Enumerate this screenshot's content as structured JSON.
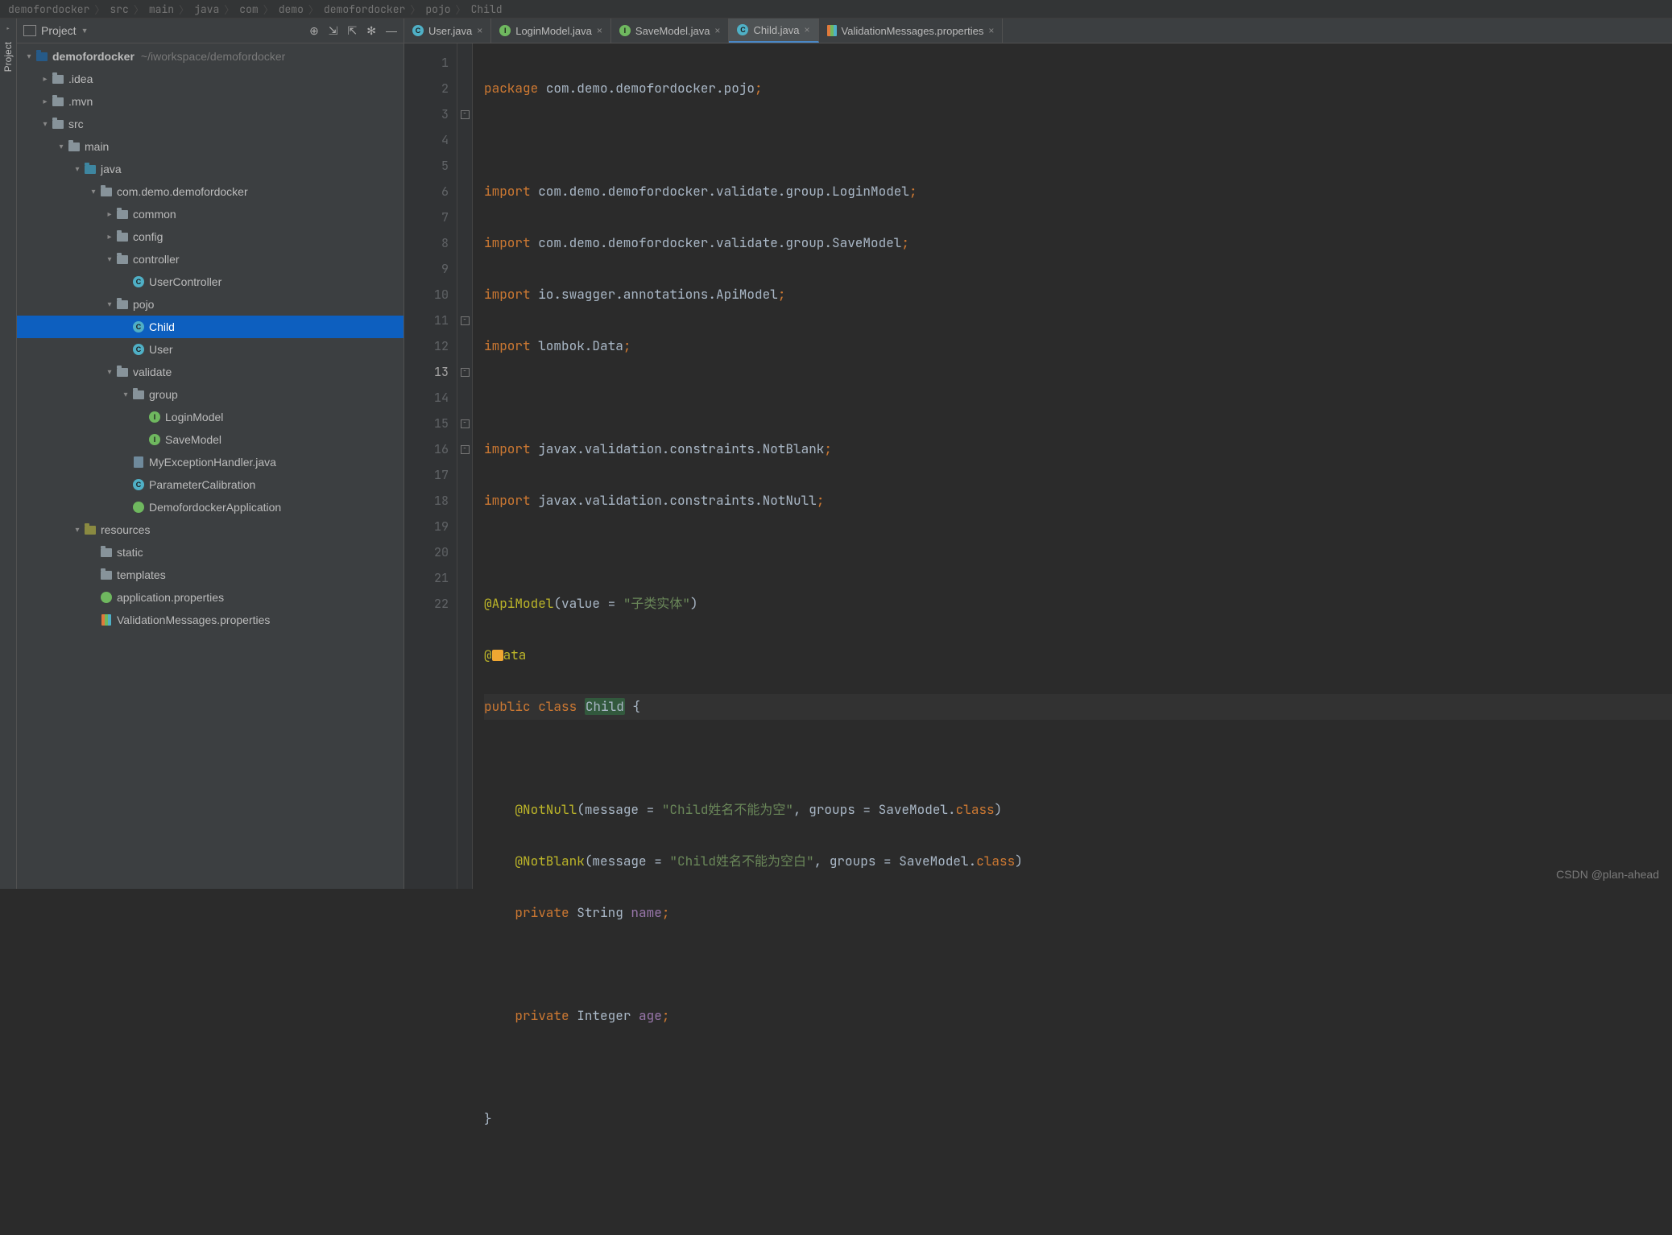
{
  "breadcrumb": [
    "demofordocker",
    "src",
    "main",
    "java",
    "com",
    "demo",
    "demofordocker",
    "pojo",
    "Child"
  ],
  "project_label": "Project",
  "tree": {
    "root": {
      "name": "demofordocker",
      "hint": "~/iworkspace/demofordocker"
    },
    "idea": ".idea",
    "mvn": ".mvn",
    "src": "src",
    "main": "main",
    "java": "java",
    "pkg": "com.demo.demofordocker",
    "common": "common",
    "config": "config",
    "controller": "controller",
    "usercontroller": "UserController",
    "pojo": "pojo",
    "child": "Child",
    "user": "User",
    "validate": "validate",
    "group": "group",
    "loginmodel": "LoginModel",
    "savemodel": "SaveModel",
    "myexh": "MyExceptionHandler.java",
    "paramcal": "ParameterCalibration",
    "demoapp": "DemofordockerApplication",
    "resources": "resources",
    "static": "static",
    "templates": "templates",
    "appprops": "application.properties",
    "valmsg": "ValidationMessages.properties"
  },
  "tabs": [
    {
      "icon": "c",
      "label": "User.java",
      "active": false
    },
    {
      "icon": "i",
      "label": "LoginModel.java",
      "active": false
    },
    {
      "icon": "i",
      "label": "SaveModel.java",
      "active": false
    },
    {
      "icon": "c",
      "label": "Child.java",
      "active": true
    },
    {
      "icon": "props",
      "label": "ValidationMessages.properties",
      "active": false
    }
  ],
  "code": {
    "l1": {
      "kw": "package ",
      "rest": "com.demo.demofordocker.pojo",
      "semi": ";"
    },
    "l3": {
      "kw": "import ",
      "rest": "com.demo.demofordocker.validate.group.LoginModel",
      "semi": ";"
    },
    "l4": {
      "kw": "import ",
      "rest": "com.demo.demofordocker.validate.group.SaveModel",
      "semi": ";"
    },
    "l5": {
      "kw": "import ",
      "rest": "io.swagger.annotations.ApiModel",
      "semi": ";"
    },
    "l6": {
      "kw": "import ",
      "rest": "lombok.Data",
      "semi": ";"
    },
    "l8": {
      "kw": "import ",
      "rest": "javax.validation.constraints.NotBlank",
      "semi": ";"
    },
    "l9": {
      "kw": "import ",
      "rest": "javax.validation.constraints.NotNull",
      "semi": ";"
    },
    "l11": {
      "ann": "@ApiModel",
      "paren": "(value = ",
      "str": "\"子类实体\"",
      "close": ")"
    },
    "l12": {
      "ann": "@Data"
    },
    "l13": {
      "kw1": "public ",
      "kw2": "class ",
      "name": "Child",
      "brace": " {"
    },
    "l15": {
      "ann": "@NotNull",
      "paren": "(message = ",
      "str": "\"Child姓名不能为空\"",
      "mid": ", groups = SaveModel.",
      "kw": "class",
      "close": ")"
    },
    "l16": {
      "ann": "@NotBlank",
      "paren": "(message = ",
      "str": "\"Child姓名不能为空白\"",
      "mid": ", groups = SaveModel.",
      "kw": "class",
      "close": ")"
    },
    "l17": {
      "kw": "private ",
      "type": "String ",
      "name": "name",
      "semi": ";"
    },
    "l19": {
      "kw": "private ",
      "type": "Integer ",
      "name": "age",
      "semi": ";"
    },
    "l21": {
      "brace": "}"
    }
  },
  "watermark": "CSDN @plan-ahead"
}
